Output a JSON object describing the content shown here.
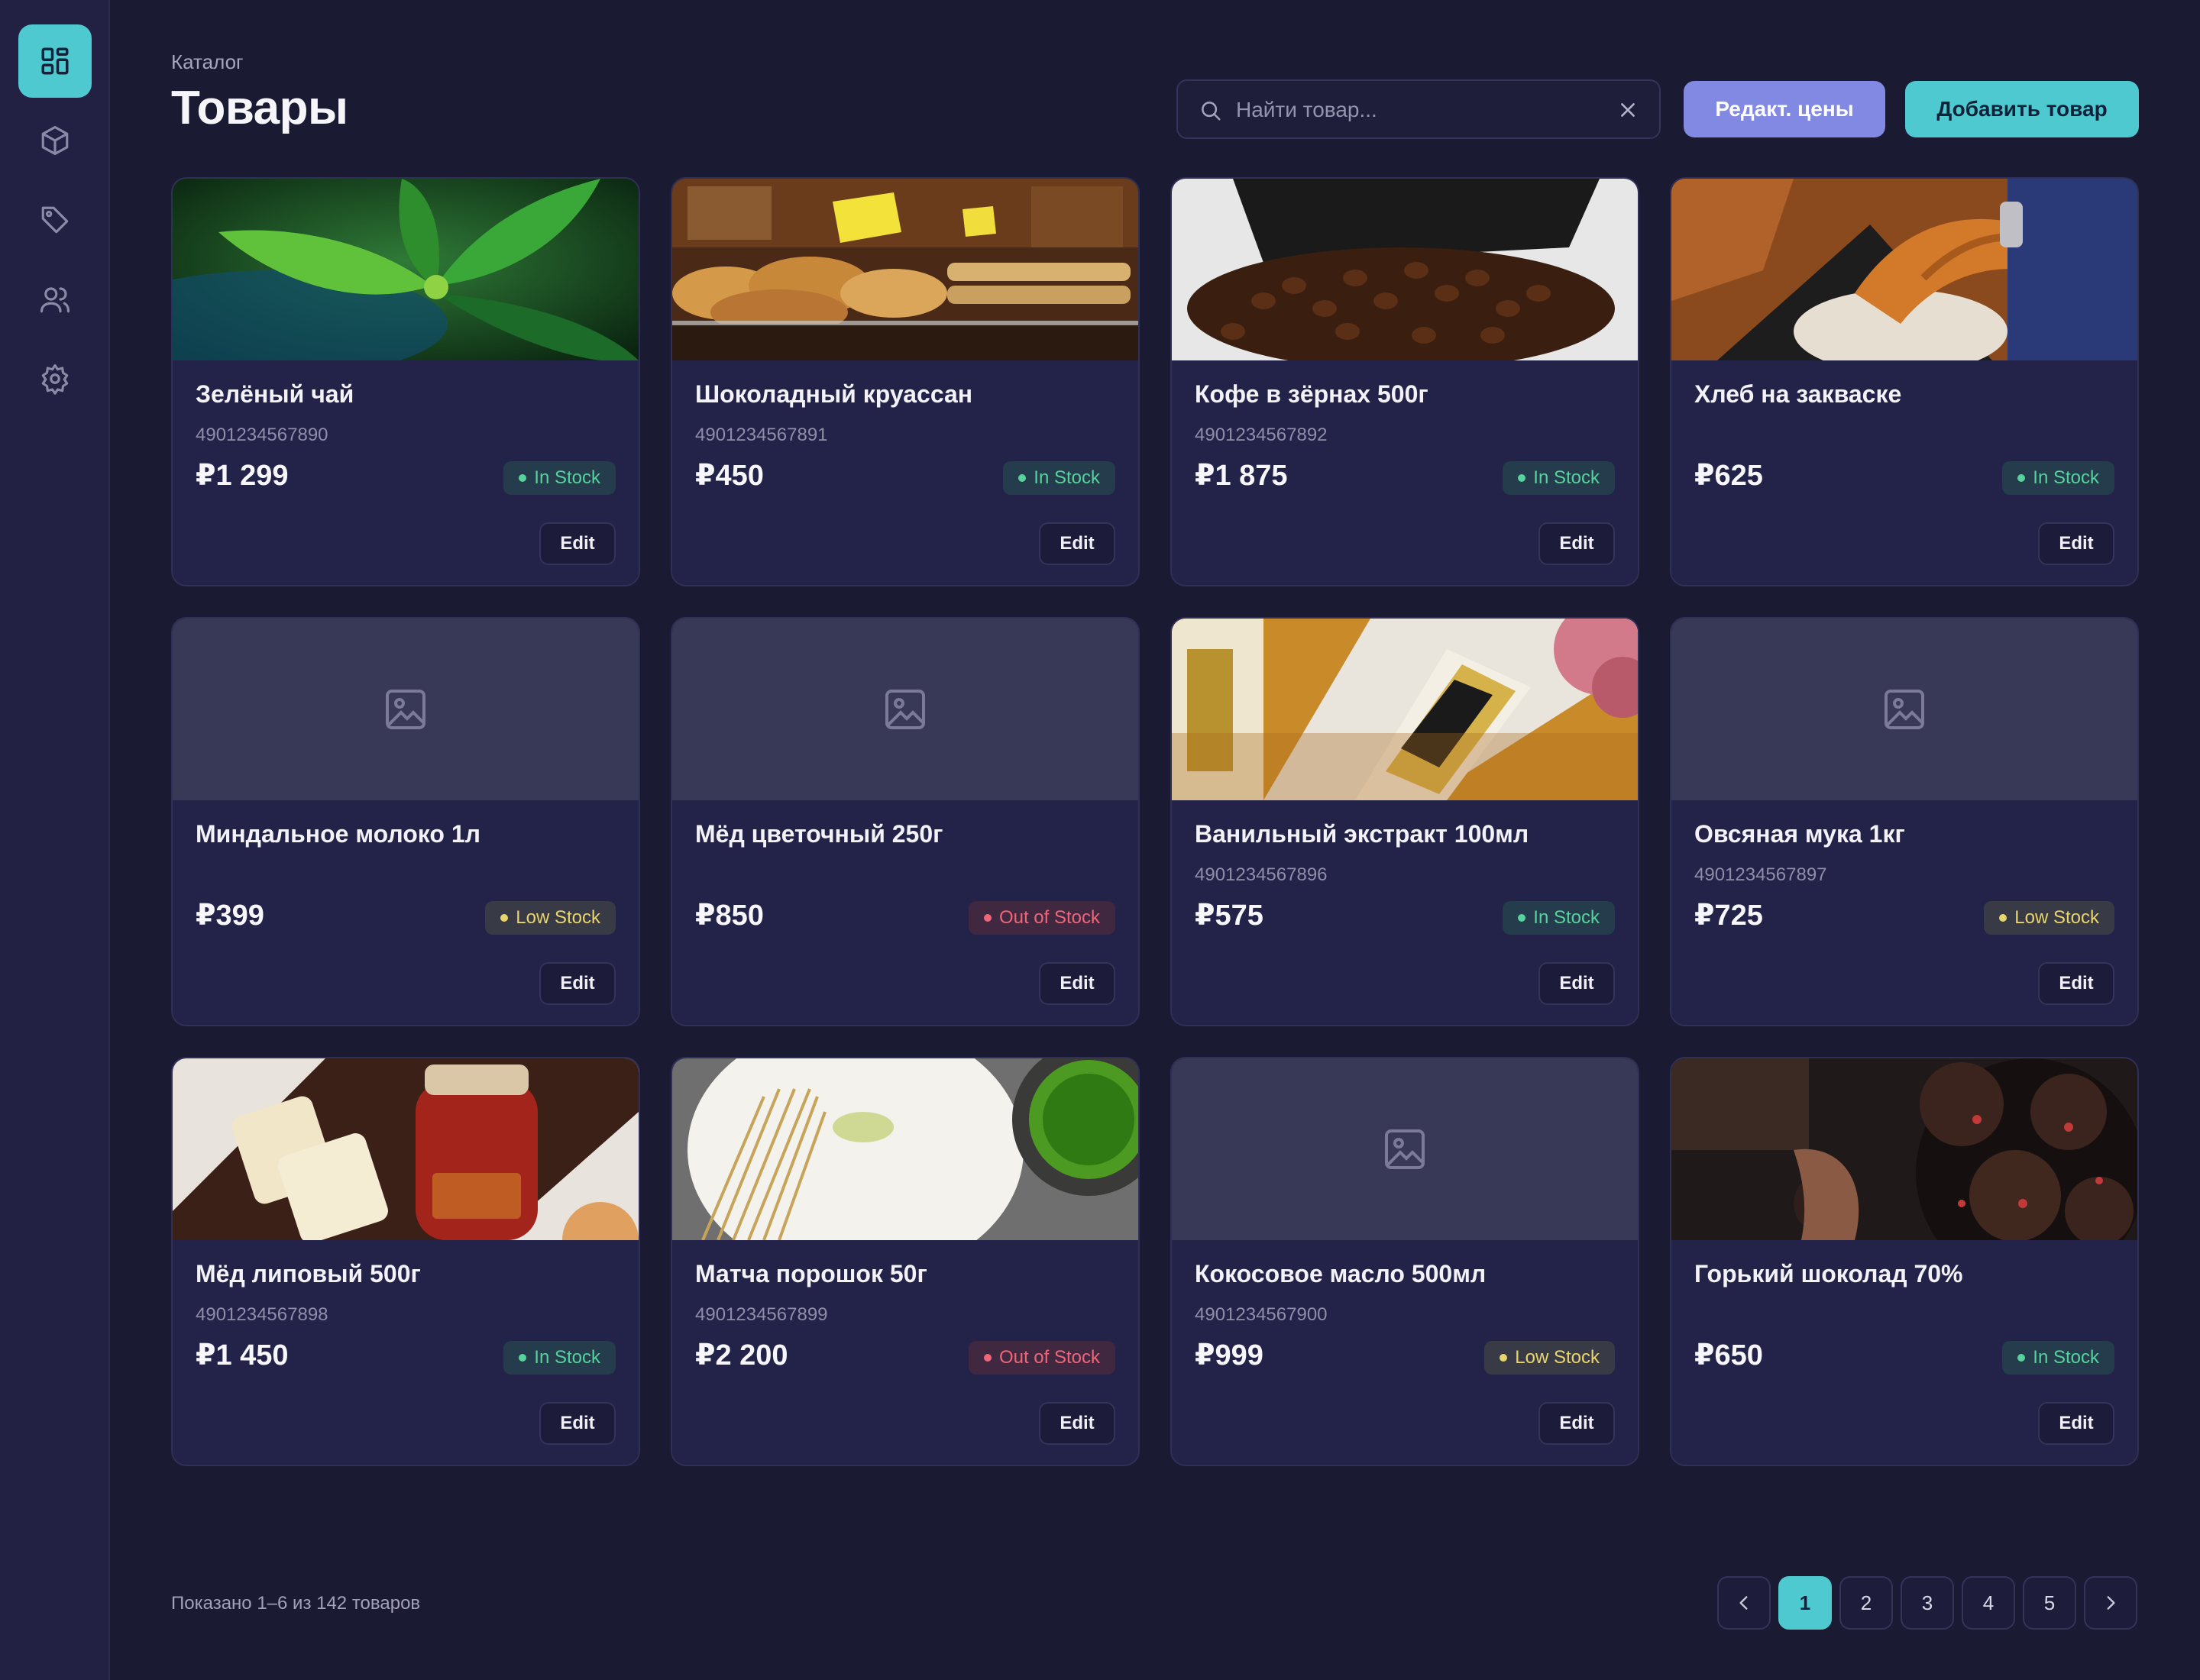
{
  "sidebar": {
    "items": [
      {
        "icon": "dashboard-icon",
        "active": true
      },
      {
        "icon": "box-icon",
        "active": false
      },
      {
        "icon": "tag-icon",
        "active": false
      },
      {
        "icon": "users-icon",
        "active": false
      },
      {
        "icon": "gear-icon",
        "active": false
      }
    ]
  },
  "header": {
    "breadcrumb": "Каталог",
    "title": "Товары",
    "search_placeholder": "Найти товар...",
    "edit_prices_label": "Редакт. цены",
    "add_product_label": "Добавить товар"
  },
  "products": [
    {
      "name": "Зелёный чай",
      "sku": "4901234567890",
      "price": "₽1 299",
      "status": "In Stock",
      "edit": "Edit",
      "image": "green-tea-leaves"
    },
    {
      "name": "Шоколадный круассан",
      "sku": "4901234567891",
      "price": "₽450",
      "status": "In Stock",
      "edit": "Edit",
      "image": "bakery-croissants"
    },
    {
      "name": "Кофе в зёрнах 500г",
      "sku": "4901234567892",
      "price": "₽1 875",
      "status": "In Stock",
      "edit": "Edit",
      "image": "coffee-beans"
    },
    {
      "name": "Хлеб на закваске",
      "sku": "",
      "price": "₽625",
      "status": "In Stock",
      "edit": "Edit",
      "image": "dough-hands"
    },
    {
      "name": "Миндальное молоко 1л",
      "sku": "",
      "price": "₽399",
      "status": "Low Stock",
      "edit": "Edit",
      "image": "placeholder"
    },
    {
      "name": "Мёд цветочный 250г",
      "sku": "",
      "price": "₽850",
      "status": "Out of Stock",
      "edit": "Edit",
      "image": "placeholder"
    },
    {
      "name": "Ванильный экстракт 100мл",
      "sku": "4901234567896",
      "price": "₽575",
      "status": "In Stock",
      "edit": "Edit",
      "image": "serum-bottle"
    },
    {
      "name": "Овсяная мука 1кг",
      "sku": "4901234567897",
      "price": "₽725",
      "status": "Low Stock",
      "edit": "Edit",
      "image": "placeholder"
    },
    {
      "name": "Мёд липовый 500г",
      "sku": "4901234567898",
      "price": "₽1 450",
      "status": "In Stock",
      "edit": "Edit",
      "image": "bread-jam-jar"
    },
    {
      "name": "Матча порошок 50г",
      "sku": "4901234567899",
      "price": "₽2 200",
      "status": "Out of Stock",
      "edit": "Edit",
      "image": "matcha-whisk"
    },
    {
      "name": "Кокосовое масло 500мл",
      "sku": "4901234567900",
      "price": "₽999",
      "status": "Low Stock",
      "edit": "Edit",
      "image": "placeholder"
    },
    {
      "name": "Горький шоколад 70%",
      "sku": "",
      "price": "₽650",
      "status": "In Stock",
      "edit": "Edit",
      "image": "chocolate-cookies"
    }
  ],
  "footer": {
    "summary": "Показано 1–6 из 142 товаров",
    "pages": [
      "1",
      "2",
      "3",
      "4",
      "5"
    ],
    "current_page": "1"
  },
  "colors": {
    "background": "#1b1a33",
    "sidebar": "#222143",
    "card": "#232248",
    "accent": "#4ec9cf",
    "secondary_button": "#8189e2",
    "in_stock": "#56d39c",
    "low_stock": "#ead56c",
    "out_of_stock": "#ef6678"
  }
}
